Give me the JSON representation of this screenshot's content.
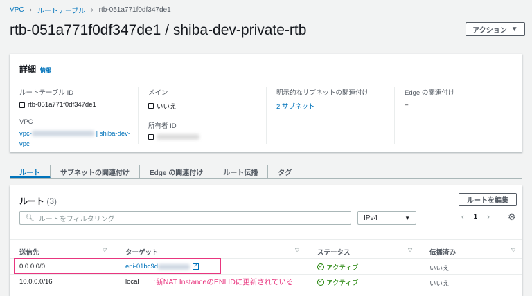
{
  "breadcrumb": [
    "VPC",
    "ルートテーブル",
    "rtb-051a771f0df347de1"
  ],
  "title": "rtb-051a771f0df347de1 / shiba-dev-private-rtb",
  "actions_label": "アクション",
  "details": {
    "heading": "詳細",
    "info": "情報",
    "route_table_id_label": "ルートテーブル ID",
    "route_table_id": "rtb-051a771f0df347de1",
    "main_label": "メイン",
    "main_value": "いいえ",
    "explicit_label": "明示的なサブネットの関連付け",
    "explicit_value": "2 サブネット",
    "edge_label": "Edge の関連付け",
    "edge_value": "–",
    "vpc_label": "VPC",
    "vpc_prefix": "vpc-",
    "vpc_name": "| shiba-dev-",
    "vpc_name2": "vpc",
    "owner_label": "所有者 ID"
  },
  "tabs": [
    "ルート",
    "サブネットの関連付け",
    "Edge の関連付け",
    "ルート伝播",
    "タグ"
  ],
  "routes": {
    "heading": "ルート",
    "count": "(3)",
    "edit_label": "ルートを編集",
    "filter_placeholder": "ルートをフィルタリング",
    "ip_select": "IPv4",
    "page": "1",
    "columns": [
      "送信先",
      "ターゲット",
      "ステータス",
      "伝播済み"
    ],
    "rows": [
      {
        "dest": "0.0.0.0/0",
        "target": "eni-01bc9d",
        "status": "アクティブ",
        "propagated": "いいえ"
      },
      {
        "dest": "10.0.0.0/16",
        "target": "local",
        "status": "アクティブ",
        "propagated": "いいえ"
      }
    ]
  },
  "annotation": "↑新NAT InstanceのENI IDに更新されている"
}
